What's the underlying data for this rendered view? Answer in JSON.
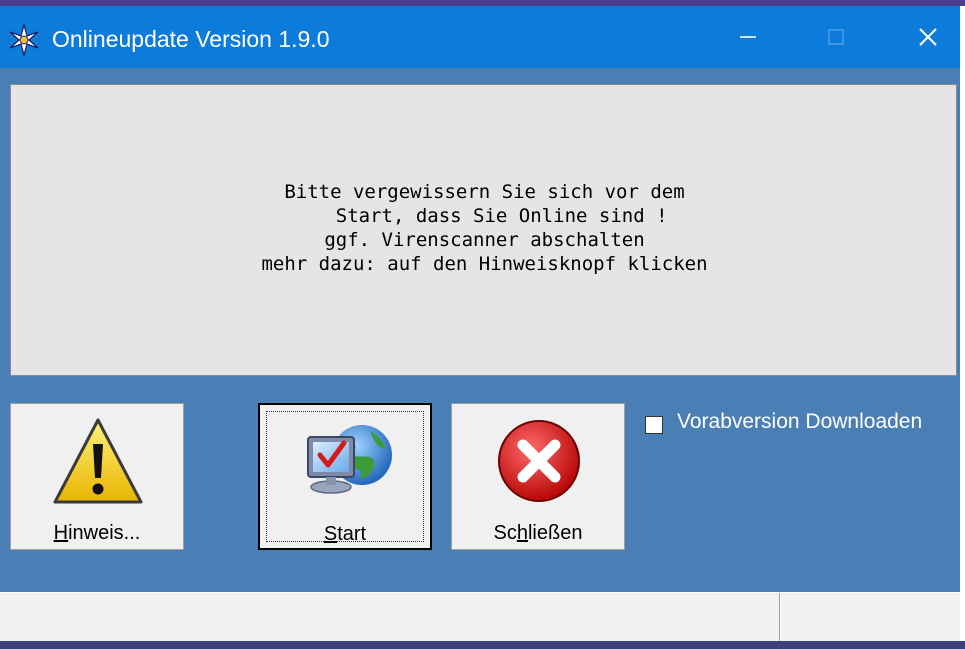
{
  "window": {
    "title": "Onlineupdate Version 1.9.0",
    "minimize_glyph": "—",
    "maximize_glyph": "☐",
    "close_glyph": "✕"
  },
  "message": {
    "line1": "Bitte vergewissern Sie sich vor dem",
    "line2": "   Start, dass Sie Online sind !",
    "line3": "ggf. Virenscanner abschalten",
    "line4": "mehr dazu: auf den Hinweisknopf klicken"
  },
  "buttons": {
    "hinweis": {
      "mnemonic": "H",
      "rest": "inweis...",
      "icon": "warning-icon"
    },
    "start": {
      "mnemonic": "S",
      "rest": "tart",
      "icon": "globe-monitor-icon"
    },
    "schliessen": {
      "pre": "Sc",
      "mnemonic": "h",
      "rest": "ließen",
      "icon": "error-x-icon"
    }
  },
  "options": {
    "prerelease_label": "Vorabversion Downloaden",
    "prerelease_checked": false
  },
  "statusbar": {
    "left": "",
    "right": ""
  },
  "colors": {
    "titlebar": "#0c7bd9",
    "window_bg": "#4a7fb5",
    "panel_bg": "#e5e5e5"
  }
}
